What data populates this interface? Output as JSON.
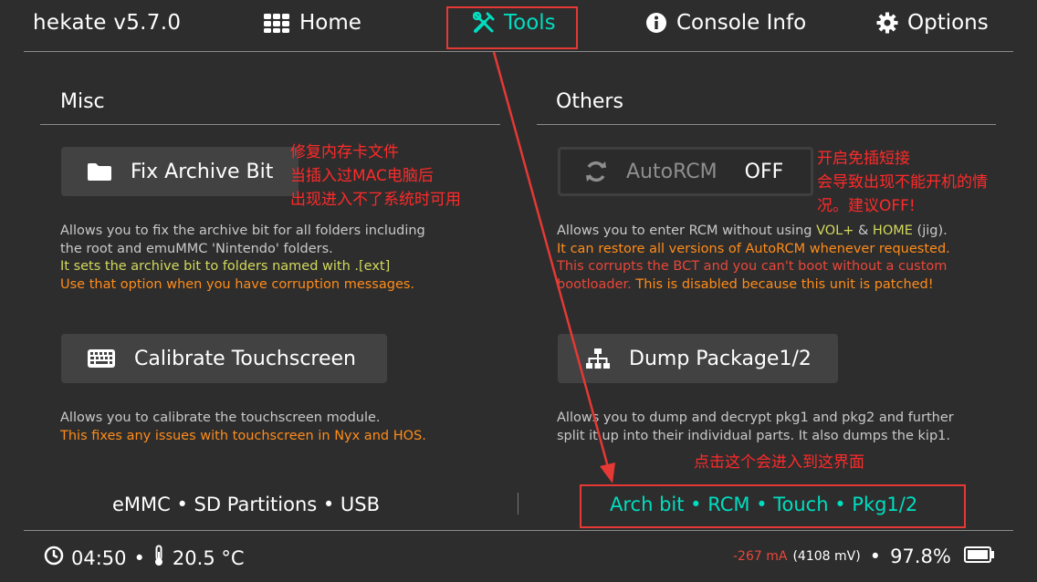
{
  "header": {
    "title": "hekate v5.7.0",
    "tabs": [
      {
        "label": "Home",
        "icon": "grid-icon"
      },
      {
        "label": "Tools",
        "icon": "tools-icon",
        "selected": true
      },
      {
        "label": "Console Info",
        "icon": "info-icon"
      },
      {
        "label": "Options",
        "icon": "gear-icon"
      }
    ]
  },
  "misc": {
    "title": "Misc",
    "fix_archive": {
      "label": "Fix Archive Bit",
      "desc": [
        "Allows you to fix the archive bit for all folders including",
        "the root and emuMMC 'Nintendo' folders.",
        "It sets the archive bit to folders named with .[ext]",
        "Use that option when you have corruption messages."
      ]
    },
    "calibrate": {
      "label": "Calibrate Touchscreen",
      "desc": [
        "Allows you to calibrate the touchscreen module.",
        "This fixes any issues with touchscreen in Nyx and HOS."
      ]
    }
  },
  "others": {
    "title": "Others",
    "autorcm": {
      "label": "AutoRCM",
      "state": "OFF",
      "desc1_a": "Allows you to enter RCM without using ",
      "desc1_vol": "VOL+",
      "desc1_amp": " & ",
      "desc1_home": "HOME",
      "desc1_b": " (jig).",
      "desc2": "It can restore all versions of AutoRCM whenever requested.",
      "desc3": "This corrupts the BCT and you can't boot without a custom",
      "desc4_a": "bootloader. ",
      "desc4_b": "This is disabled because this unit is patched!"
    },
    "dump": {
      "label": "Dump Package1/2",
      "desc": [
        "Allows you to dump and decrypt pkg1 and pkg2 and further",
        "split it up into their individual parts. It also dumps the kip1."
      ]
    }
  },
  "subnav": {
    "left": "eMMC • SD Partitions • USB",
    "right": "Arch bit • RCM • Touch • Pkg1/2"
  },
  "annotations": {
    "fix_note": [
      "修复内存卡文件",
      "当插入过MAC电脑后",
      "出现进入不了系统时可用"
    ],
    "autorcm_note": [
      "开启免插短接",
      "会导致出现不能开机的情",
      "况。建议OFF!"
    ],
    "click_note": "点击这个会进入到这界面"
  },
  "status": {
    "time": "04:50",
    "temp": "20.5 °C",
    "current": "-267 mA",
    "voltage": "(4108 mV)",
    "battery": "97.8%"
  },
  "colors": {
    "background": "#2d2d2d",
    "accent": "#00ddc0",
    "warning": "#ff8c1a",
    "annotation": "#e53935"
  }
}
